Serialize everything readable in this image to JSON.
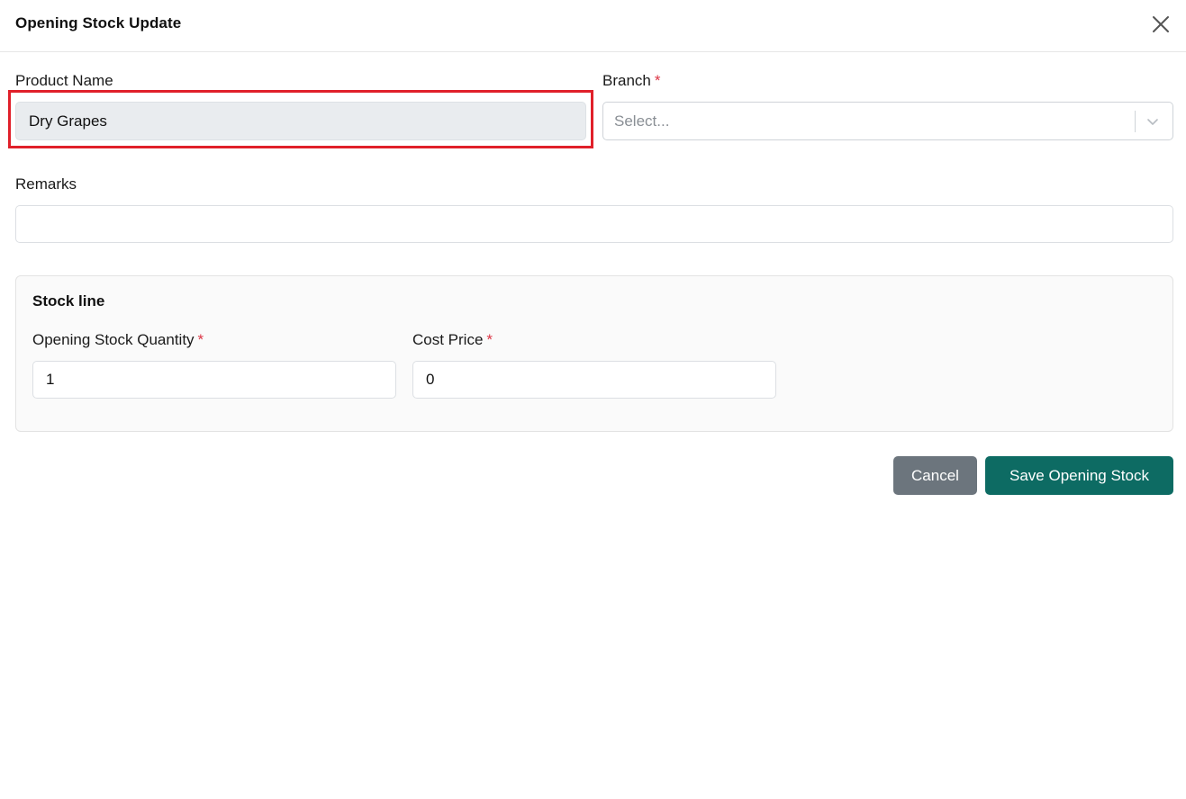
{
  "modal": {
    "title": "Opening Stock Update",
    "close_icon": "close-icon"
  },
  "form": {
    "product_name": {
      "label": "Product Name",
      "value": "Dry Grapes"
    },
    "branch": {
      "label": "Branch",
      "required_mark": "*",
      "placeholder": "Select..."
    },
    "remarks": {
      "label": "Remarks",
      "value": ""
    }
  },
  "stock_line": {
    "title": "Stock line",
    "quantity": {
      "label": "Opening Stock Quantity",
      "required_mark": "*",
      "value": "1"
    },
    "cost_price": {
      "label": "Cost Price",
      "required_mark": "*",
      "value": "0"
    }
  },
  "actions": {
    "cancel_label": "Cancel",
    "save_label": "Save Opening Stock"
  },
  "colors": {
    "highlight": "#e0202a",
    "required": "#dc3545",
    "cancel_bg": "#6c757d",
    "save_bg": "#0d6b63"
  }
}
